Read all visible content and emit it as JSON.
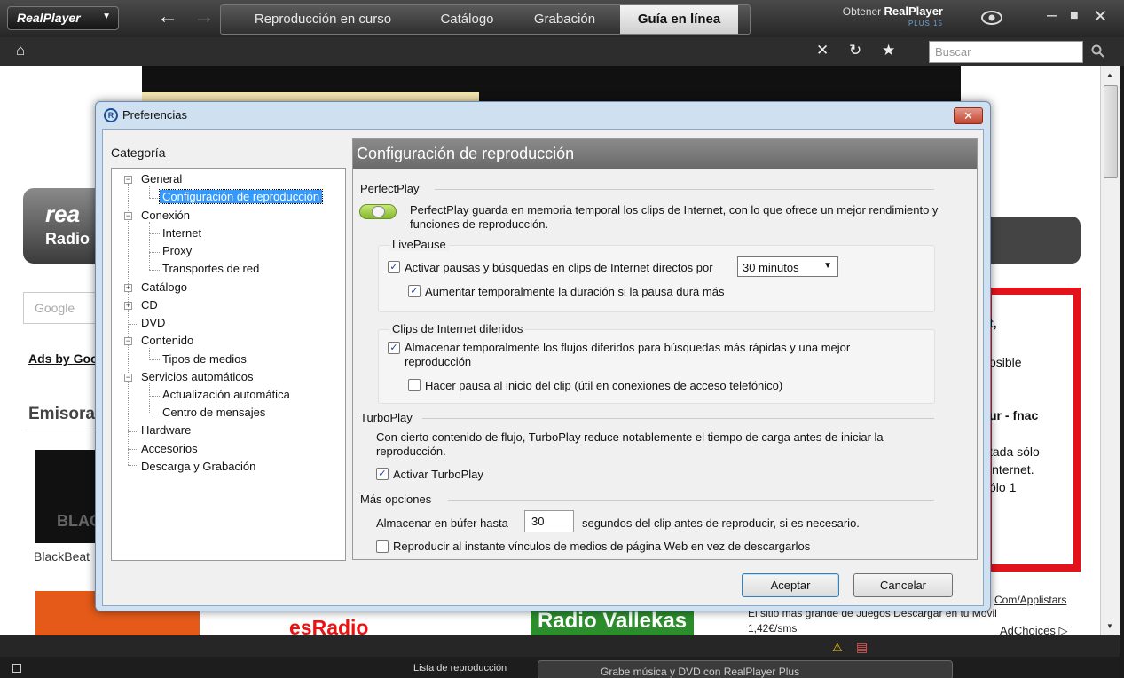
{
  "app": {
    "logo": "RealPlayer",
    "nav_back": "←",
    "nav_forward": "→",
    "tabs": [
      {
        "label": "Reproducción en curso"
      },
      {
        "label": "Catálogo"
      },
      {
        "label": "Grabación"
      },
      {
        "label": "Guía en línea"
      }
    ],
    "active_tab": "Guía en línea",
    "get_realplayer_prefix": "Obtener ",
    "get_realplayer_brand": "RealPlayer",
    "get_realplayer_plus": "PLUS 15",
    "search_placeholder": "Buscar"
  },
  "webpage": {
    "real_logo": "rea",
    "radio_label": "Radio",
    "google_label": "Google",
    "ads_by": "Ads by Goo",
    "emisoras": "Emisora",
    "black_label": "BLAC",
    "blackbeat": "BlackBeat",
    "esradio": "esRadio",
    "radio_vallekas": "Radio Vallekas",
    "ad_lines": [
      "t,",
      "osible",
      "ur - fnac",
      "tada sólo",
      "internet.",
      "ólo 1"
    ],
    "applistars": "Com/Applistars",
    "ad_text_1": "El sitio más grande de Juegos Descargar en tu Móvil",
    "ad_text_2": "1,42€/sms",
    "adchoices": "AdChoices ▷"
  },
  "statusbar": {
    "playlist": "Lista de reproducción",
    "now_playing": "Grabe música y DVD con RealPlayer Plus"
  },
  "dialog": {
    "title": "Preferencias",
    "category_label": "Categoría",
    "tree": [
      {
        "label": "General",
        "level": 0,
        "expander": "−"
      },
      {
        "label": "Configuración de reproducción",
        "level": 1,
        "selected": true
      },
      {
        "label": "Conexión",
        "level": 0,
        "expander": "−"
      },
      {
        "label": "Internet",
        "level": 1
      },
      {
        "label": "Proxy",
        "level": 1
      },
      {
        "label": "Transportes de red",
        "level": 1
      },
      {
        "label": "Catálogo",
        "level": 0,
        "expander": "+"
      },
      {
        "label": "CD",
        "level": 0,
        "expander": "+"
      },
      {
        "label": "DVD",
        "level": 0
      },
      {
        "label": "Contenido",
        "level": 0,
        "expander": "−"
      },
      {
        "label": "Tipos de medios",
        "level": 1
      },
      {
        "label": "Servicios automáticos",
        "level": 0,
        "expander": "−"
      },
      {
        "label": "Actualización automática",
        "level": 1
      },
      {
        "label": "Centro de mensajes",
        "level": 1
      },
      {
        "label": "Hardware",
        "level": 0
      },
      {
        "label": "Accesorios",
        "level": 0
      },
      {
        "label": "Descarga y Grabación",
        "level": 0
      }
    ],
    "panel_title": "Configuración de reproducción",
    "perfectplay": {
      "heading": "PerfectPlay",
      "enabled": true,
      "description": "PerfectPlay guarda en memoria temporal los clips de Internet, con lo que ofrece un mejor rendimiento y funciones de reproducción."
    },
    "livepause": {
      "heading": "LivePause",
      "enable_label": "Activar pausas y búsquedas en clips de Internet directos por",
      "enable_checked": true,
      "duration_value": "30 minutos",
      "extend_label": "Aumentar temporalmente la duración si la pausa dura más",
      "extend_checked": true
    },
    "deferred": {
      "heading": "Clips de Internet diferidos",
      "buffer_label": "Almacenar temporalmente los flujos diferidos para búsquedas más rápidas y una mejor reproducción",
      "buffer_checked": true,
      "pause_label": "Hacer pausa al inicio del clip (útil en conexiones de acceso telefónico)",
      "pause_checked": false
    },
    "turboplay": {
      "heading": "TurboPlay",
      "description": "Con cierto contenido de flujo, TurboPlay reduce notablemente el tiempo de carga antes de iniciar la reproducción.",
      "enable_label": "Activar TurboPlay",
      "enable_checked": true
    },
    "more": {
      "heading": "Más opciones",
      "buffer_prefix": "Almacenar en búfer hasta",
      "buffer_seconds": "30",
      "buffer_suffix": "segundos del clip antes de reproducir, si es necesario.",
      "instant_label": "Reproducir al instante vínculos de medios de página Web en vez de descargarlos",
      "instant_checked": false
    },
    "ok_label": "Aceptar",
    "cancel_label": "Cancelar"
  }
}
